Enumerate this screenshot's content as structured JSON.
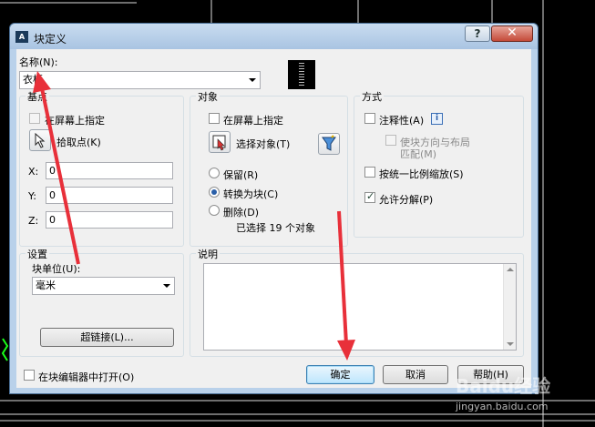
{
  "window": {
    "title": "块定义",
    "app_icon": "autocad-icon"
  },
  "name": {
    "label": "名称(N):",
    "value": "衣柜"
  },
  "base_point": {
    "title": "基点",
    "specify_on_screen": "在屏幕上指定",
    "pick_label": "拾取点(K)",
    "x_label": "X:",
    "x_value": "0",
    "y_label": "Y:",
    "y_value": "0",
    "z_label": "Z:",
    "z_value": "0"
  },
  "objects": {
    "title": "对象",
    "specify_on_screen": "在屏幕上指定",
    "select_label": "选择对象(T)",
    "retain": "保留(R)",
    "convert": "转换为块(C)",
    "delete": "删除(D)",
    "selected_text": "已选择 19 个对象"
  },
  "behavior": {
    "title": "方式",
    "annotative": "注释性(A)",
    "match_orientation_l1": "使块方向与布局",
    "match_orientation_l2": "匹配(M)",
    "scale_uniformly": "按统一比例缩放(S)",
    "allow_exploding": "允许分解(P)"
  },
  "settings": {
    "title": "设置",
    "block_unit_label": "块单位(U):",
    "block_unit_value": "毫米",
    "hyperlink": "超链接(L)..."
  },
  "description": {
    "title": "说明",
    "value": ""
  },
  "footer": {
    "open_in_editor": "在块编辑器中打开(O)",
    "ok": "确定",
    "cancel": "取消",
    "help": "帮助(H)"
  },
  "watermark": {
    "text": "Baidu经验",
    "url": "jingyan.baidu.com"
  },
  "colors": {
    "accent": "#3c7fb1",
    "arrow": "#e8303a",
    "title_bg": "#b9d1ea"
  }
}
